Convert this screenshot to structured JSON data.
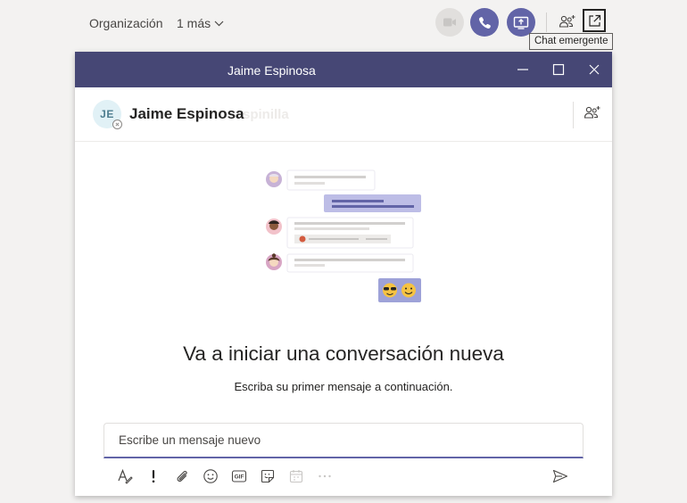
{
  "header": {
    "org_label": "Organización",
    "more_label": "1 más",
    "tooltip": "Chat emergente"
  },
  "popup": {
    "window_title": "Jaime Espinosa",
    "contact_initials": "JE",
    "contact_name": "Jaime Espinosa",
    "contact_name_ghost": "spinilla",
    "headline": "Va a iniciar una conversación nueva",
    "subline": "Escriba su primer mensaje a continuación.",
    "compose_placeholder": "Escribe un mensaje nuevo",
    "gif_label": "GIF"
  },
  "colors": {
    "brand": "#6264a7",
    "titlebar": "#464775",
    "background": "#f3f2f1"
  },
  "icons": {
    "video": "video-camera-icon",
    "call": "phone-icon",
    "share": "screen-share-icon",
    "add_people": "add-people-icon",
    "popout": "popout-icon",
    "format": "format-icon",
    "important": "exclamation-icon",
    "attach": "paperclip-icon",
    "emoji": "emoji-icon",
    "gif": "gif-icon",
    "sticker": "sticker-icon",
    "schedule": "schedule-meeting-icon",
    "more": "more-options-icon",
    "send": "send-icon"
  }
}
